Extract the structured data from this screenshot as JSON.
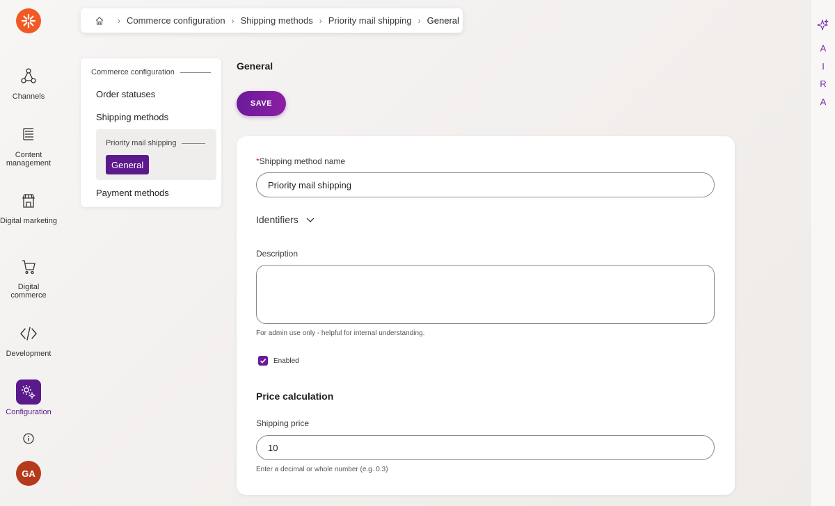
{
  "nav_rail": {
    "items": [
      {
        "label": "Channels"
      },
      {
        "label": "Content management"
      },
      {
        "label": "Digital marketing"
      },
      {
        "label": "Digital commerce"
      },
      {
        "label": "Development"
      },
      {
        "label": "Configuration",
        "active": true
      }
    ],
    "avatar_initials": "GA"
  },
  "aira": {
    "letters": [
      "A",
      "I",
      "R",
      "A"
    ]
  },
  "breadcrumb": {
    "items": [
      "Commerce configuration",
      "Shipping methods",
      "Priority mail shipping"
    ],
    "current": "General",
    "separator": "›"
  },
  "section_nav": {
    "heading": "Commerce configuration",
    "items": [
      "Order statuses",
      "Shipping methods",
      "Payment methods"
    ],
    "group": {
      "heading": "Priority mail shipping",
      "active_item": "General"
    }
  },
  "page": {
    "title": "General",
    "save_label": "SAVE"
  },
  "form": {
    "name_required_marker": "*",
    "name_label": "Shipping method name",
    "name_value": "Priority mail shipping",
    "identifiers_label": "Identifiers",
    "description_label": "Description",
    "description_value": "",
    "description_helper": "For admin use only - helpful for internal understanding.",
    "enabled_label": "Enabled",
    "enabled_checked": true,
    "price_section_title": "Price calculation",
    "price_label": "Shipping price",
    "price_value": "10",
    "price_helper": "Enter a decimal or whole number (e.g. 0.3)"
  },
  "colors": {
    "accent": "#5b1a8c",
    "logo": "#f15a24",
    "avatar": "#b5391b",
    "required": "#d12c2c"
  },
  "icons": [
    "logo-icon",
    "channels-icon",
    "content-management-icon",
    "digital-marketing-icon",
    "digital-commerce-icon",
    "development-icon",
    "configuration-icon",
    "info-icon",
    "home-icon",
    "chevron-down-icon",
    "sparkle-icon",
    "checkmark-icon"
  ]
}
